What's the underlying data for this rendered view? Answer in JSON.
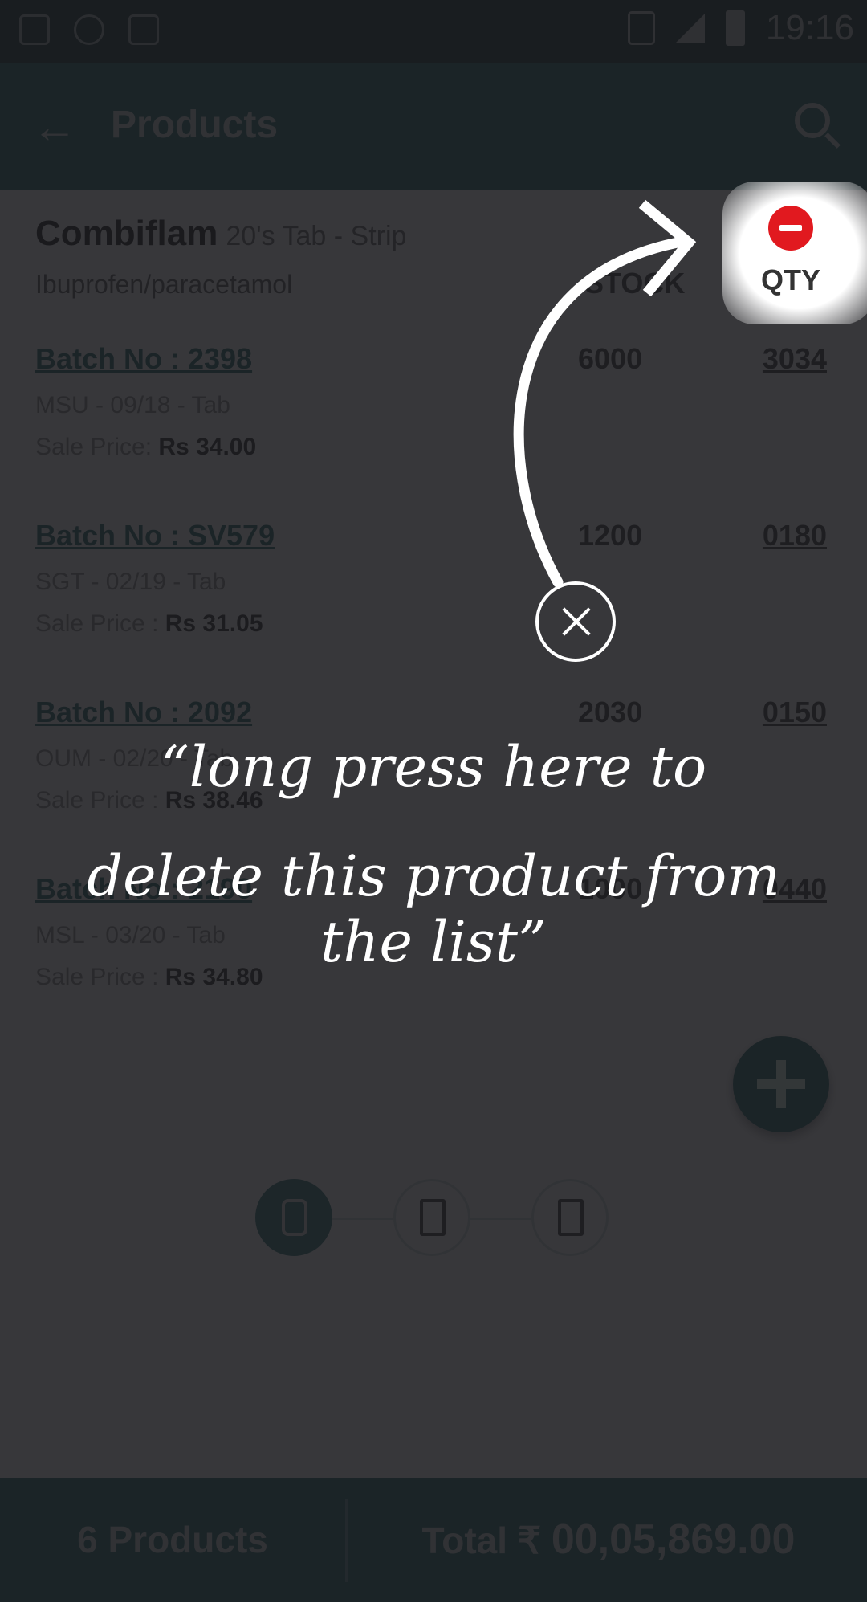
{
  "status_bar": {
    "time": "19:16"
  },
  "app_bar": {
    "title": "Products"
  },
  "product": {
    "name": "Combiflam",
    "pack": "20's Tab - Strip",
    "generic": "Ibuprofen/paracetamol",
    "stock_header": "STOCK",
    "qty_header": "QTY"
  },
  "batches": [
    {
      "batch_no": "Batch No : 2398",
      "stock": "6000",
      "qty": "3034",
      "meta": "MSU - 09/18 - Tab",
      "price_label": "Sale Price:",
      "price": "Rs 34.00"
    },
    {
      "batch_no": "Batch No : SV579",
      "stock": "1200",
      "qty": "0180",
      "meta": "SGT - 02/19 - Tab",
      "price_label": "Sale Price :",
      "price": "Rs 31.05"
    },
    {
      "batch_no": "Batch No : 2092",
      "stock": "2030",
      "qty": "0150",
      "meta": "OUM - 02/20 - Tab",
      "price_label": "Sale Price :",
      "price": "Rs 38.46"
    },
    {
      "batch_no": "Batch No : 2190",
      "stock": "1000",
      "qty": "0440",
      "meta": "MSL - 03/20 - Tab",
      "price_label": "Sale Price :",
      "price": "Rs 34.80"
    }
  ],
  "bottom_bar": {
    "products_count": "6 Products",
    "total_label": "Total ₹",
    "total_value": "00,05,869.00"
  },
  "tutorial": {
    "line1": "“long press here to",
    "line2": "delete this product from the list”"
  },
  "colors": {
    "primary": "#1f6266",
    "danger": "#e1191f",
    "overlay": "#1b1b1f"
  }
}
